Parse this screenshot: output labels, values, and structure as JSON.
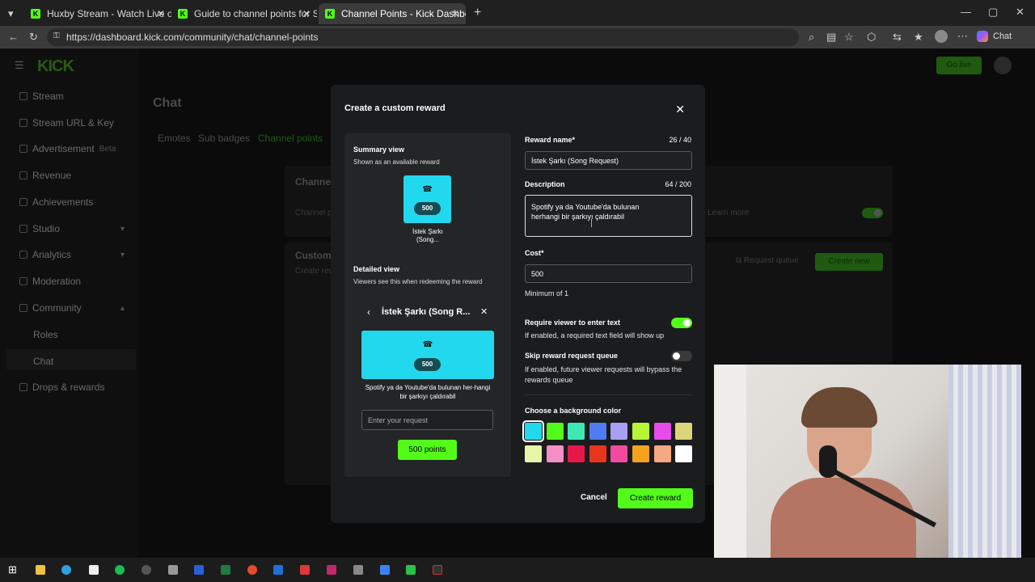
{
  "browser": {
    "tabs": [
      {
        "title": "Huxby Stream - Watch Live o"
      },
      {
        "title": "Guide to channel points for Strean"
      },
      {
        "title": "Channel Points - Kick Dashboard"
      }
    ],
    "url": "https://dashboard.kick.com/community/chat/channel-points",
    "chat_label": "Chat"
  },
  "app": {
    "logo": "KICK",
    "go_live": "Go live",
    "sidebar": {
      "items": [
        "Stream",
        "Stream URL & Key",
        "Advertisement",
        "Revenue",
        "Achievements",
        "Studio",
        "Analytics",
        "Moderation",
        "Community",
        "Roles",
        "Chat",
        "Drops & rewards"
      ],
      "beta": "Beta"
    },
    "page_title": "Chat",
    "tabs": [
      "Emotes",
      "Sub badges",
      "Channel points"
    ],
    "channel_heading": "Channe",
    "channel_sub": "Channel p",
    "learn_more": "Learn more",
    "custom_heading": "Custom",
    "custom_sub": "Create rew",
    "request_queue": "Request queue",
    "create_new": "Create new"
  },
  "modal": {
    "title": "Create a custom reward",
    "summary_title": "Summary view",
    "summary_sub": "Shown as an available reward",
    "cost_pill": "500",
    "summary_name": "İstek Şarkı (Song...",
    "detailed_title": "Detailed view",
    "detailed_sub": "Viewers see this when redeeming the reward",
    "detail_header": "İstek Şarkı (Song R...",
    "detail_desc": "Spotify ya da Youtube'da bulunan her-hangi bir şarkıyı çaldırabil",
    "request_placeholder": "Enter your request",
    "points_button": "500 points",
    "reward_name_label": "Reward name*",
    "reward_name_count": "26 / 40",
    "reward_name_value": "İstek Şarkı (Song Request)",
    "description_label": "Description",
    "description_count": "64 / 200",
    "description_value": "Spotify ya da Youtube'da bulunan herhangi bir şarkıyı çaldırabil",
    "cost_label": "Cost*",
    "cost_value": "500",
    "cost_hint": "Minimum of 1",
    "require_label": "Require viewer to enter text",
    "require_hint": "If enabled, a required text field will show up",
    "require_on": true,
    "skip_label": "Skip reward request queue",
    "skip_hint": "If enabled, future viewer requests will bypass the rewards queue",
    "skip_on": false,
    "color_label": "Choose a background color",
    "colors": [
      "#22d8ee",
      "#53fc18",
      "#3ee8b5",
      "#4f7cf0",
      "#a8a0f5",
      "#b8f536",
      "#e64ce8",
      "#ddd57a",
      "#e3f7a6",
      "#f58fc8",
      "#e8174a",
      "#e8361e",
      "#f24aa0",
      "#f5a21e",
      "#f5a882",
      "#ffffff"
    ],
    "selected_color": "#22d8ee",
    "cancel": "Cancel",
    "create": "Create reward"
  }
}
